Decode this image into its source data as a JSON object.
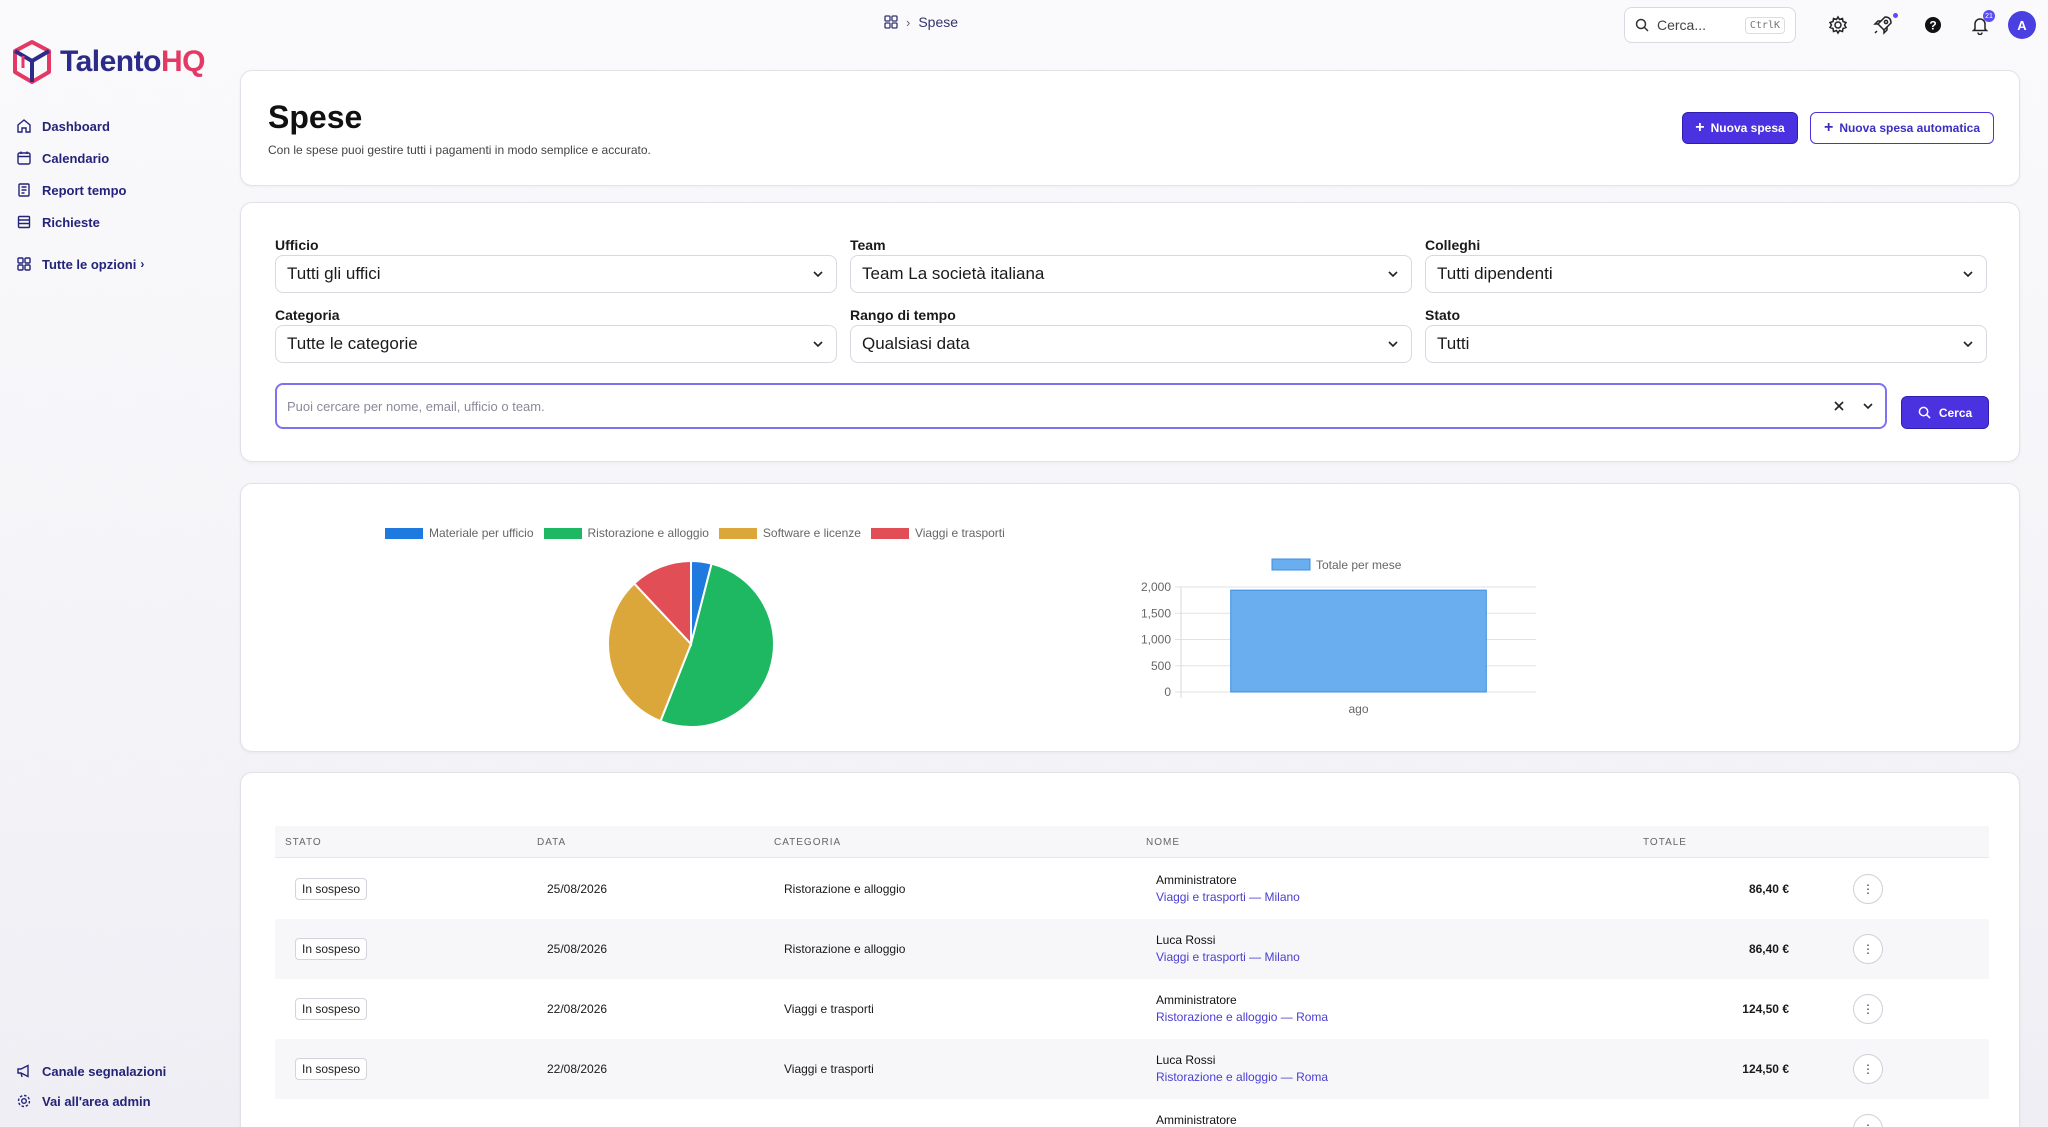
{
  "app": {
    "brand_a": "Talento",
    "brand_b": "HQ"
  },
  "sidebar": {
    "items": [
      {
        "label": "Dashboard"
      },
      {
        "label": "Calendario"
      },
      {
        "label": "Report tempo"
      },
      {
        "label": "Richieste"
      },
      {
        "label": "Tutte le opzioni"
      }
    ],
    "bottom": [
      {
        "label": "Canale segnalazioni"
      },
      {
        "label": "Vai all'area admin"
      }
    ]
  },
  "topbar": {
    "breadcrumb": "Spese",
    "search_placeholder": "Cerca...",
    "search_shortcut": "CtrlK",
    "notif_count": "21",
    "avatar": "A"
  },
  "header": {
    "title": "Spese",
    "subtitle": "Con le spese puoi gestire tutti i pagamenti in modo semplice e accurato.",
    "new_expense": "Nuova spesa",
    "new_auto_expense": "Nuova spesa automatica"
  },
  "filters": {
    "ufficio": {
      "label": "Ufficio",
      "value": "Tutti gli uffici"
    },
    "team": {
      "label": "Team",
      "value": "Team La società italiana"
    },
    "colleghi": {
      "label": "Colleghi",
      "value": "Tutti dipendenti"
    },
    "categoria": {
      "label": "Categoria",
      "value": "Tutte le categorie"
    },
    "rango": {
      "label": "Rango di tempo",
      "value": "Qualsiasi data"
    },
    "stato": {
      "label": "Stato",
      "value": "Tutti"
    },
    "search_placeholder": "Puoi cercare per nome, email, ufficio o team.",
    "search_button": "Cerca"
  },
  "chart_data": [
    {
      "type": "pie",
      "categories": [
        "Materiale per ufficio",
        "Ristorazione e alloggio",
        "Software e licenze",
        "Viaggi e trasporti"
      ],
      "values": [
        4,
        52,
        32,
        12
      ],
      "colors": [
        "#1f7ae0",
        "#1db861",
        "#dba63a",
        "#e24e56"
      ]
    },
    {
      "type": "bar",
      "categories": [
        "ago"
      ],
      "series": [
        {
          "name": "Totale per mese",
          "values": [
            1940
          ]
        }
      ],
      "ylim": [
        0,
        2000
      ],
      "yticks": [
        "2,000",
        "1,500",
        "1,000",
        "500",
        "0"
      ],
      "color": "#6aaeef"
    }
  ],
  "table": {
    "columns": [
      "STATO",
      "DATA",
      "CATEGORIA",
      "NOME",
      "TOTALE"
    ],
    "rows": [
      {
        "status": "In sospeso",
        "date": "25/08/2026",
        "category": "Ristorazione e alloggio",
        "name": "Amministratore",
        "detail": "Viaggi e trasporti — Milano",
        "total": "86,40 €"
      },
      {
        "status": "In sospeso",
        "date": "25/08/2026",
        "category": "Ristorazione e alloggio",
        "name": "Luca Rossi",
        "detail": "Viaggi e trasporti — Milano",
        "total": "86,40 €"
      },
      {
        "status": "In sospeso",
        "date": "22/08/2026",
        "category": "Viaggi e trasporti",
        "name": "Amministratore",
        "detail": "Ristorazione e alloggio — Roma",
        "total": "124,50 €"
      },
      {
        "status": "In sospeso",
        "date": "22/08/2026",
        "category": "Viaggi e trasporti",
        "name": "Luca Rossi",
        "detail": "Ristorazione e alloggio — Roma",
        "total": "124,50 €"
      },
      {
        "status": "",
        "date": "",
        "category": "",
        "name": "Amministratore",
        "detail": "",
        "total": ""
      }
    ]
  }
}
